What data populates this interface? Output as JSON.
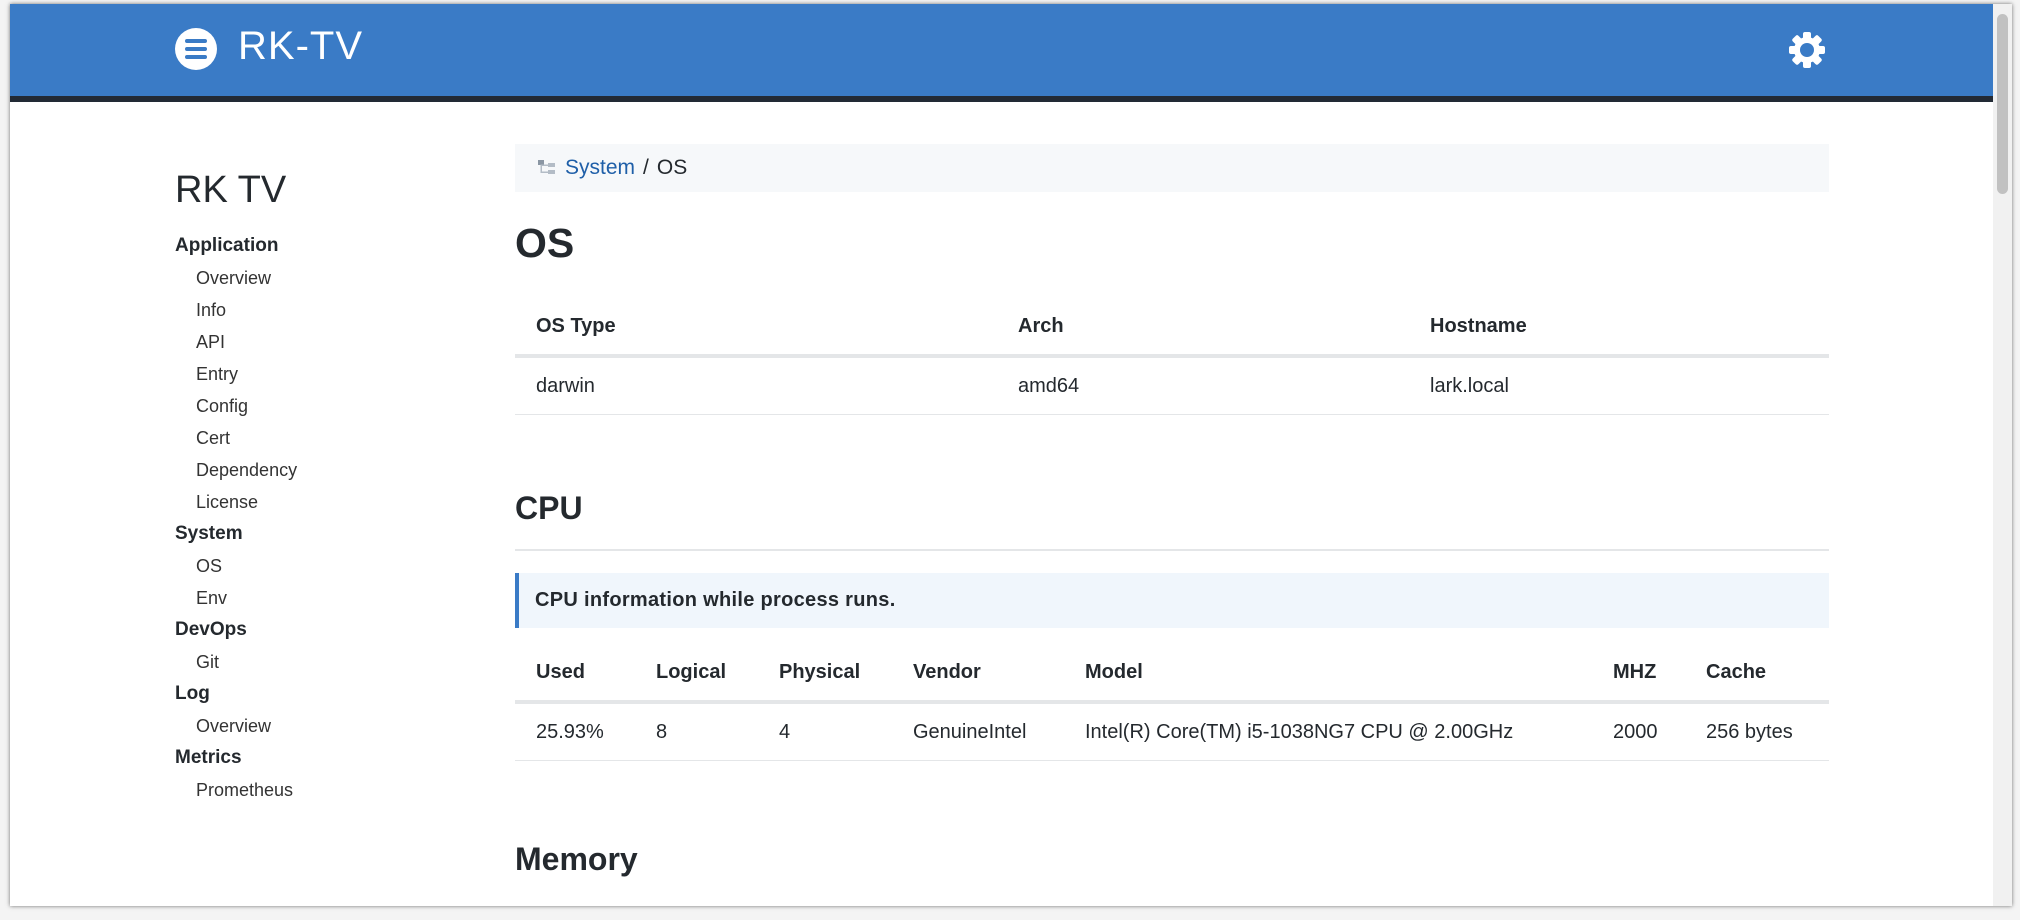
{
  "header": {
    "brand": "RK-TV",
    "menu_icon": "menu-icon",
    "settings_icon": "gear-icon",
    "color": "#3a7bc6"
  },
  "sidebar": {
    "title": "RK TV",
    "groups": [
      {
        "label": "Application",
        "items": [
          "Overview",
          "Info",
          "API",
          "Entry",
          "Config",
          "Cert",
          "Dependency",
          "License"
        ]
      },
      {
        "label": "System",
        "items": [
          "OS",
          "Env"
        ]
      },
      {
        "label": "DevOps",
        "items": [
          "Git"
        ]
      },
      {
        "label": "Log",
        "items": [
          "Overview"
        ]
      },
      {
        "label": "Metrics",
        "items": [
          "Prometheus"
        ]
      }
    ]
  },
  "breadcrumb": {
    "icon": "sitemap-icon",
    "link": "System",
    "separator": "/",
    "current": "OS"
  },
  "os": {
    "title": "OS",
    "columns": [
      "OS Type",
      "Arch",
      "Hostname"
    ],
    "row": [
      "darwin",
      "amd64",
      "lark.local"
    ]
  },
  "cpu": {
    "title": "CPU",
    "note": "CPU information while process runs.",
    "columns": [
      "Used",
      "Logical",
      "Physical",
      "Vendor",
      "Model",
      "MHZ",
      "Cache"
    ],
    "row": [
      "25.93%",
      "8",
      "4",
      "GenuineIntel",
      "Intel(R) Core(TM) i5-1038NG7 CPU @ 2.00GHz",
      "2000",
      "256 bytes"
    ]
  },
  "memory": {
    "title": "Memory"
  }
}
